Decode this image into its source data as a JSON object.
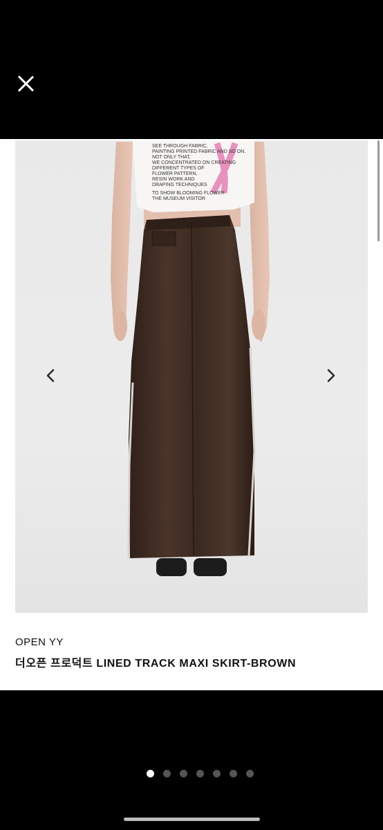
{
  "viewer": {
    "close_icon": "close-icon",
    "prev_icon": "chevron-left-icon",
    "next_icon": "chevron-right-icon",
    "active_page": 1,
    "page_count": 7
  },
  "product": {
    "brand": "OPEN YY",
    "title": "더오픈 프로덕트 LINED TRACK MAXI SKIRT-BROWN",
    "image": {
      "shirt_print": [
        "SEE THROUGH FABRIC,",
        "PAINTING PRINTED FABRIC AND SO ON.",
        "NOT ONLY THAT,",
        "WE CONCENTRATED ON CREATING",
        "DIFFERENT TYPES OF",
        "FLOWER PATTERN,",
        "RESIN WORK AND",
        "DRAPING TECHNIQUES",
        "",
        "TO SHOW BLOOMING FLOWER",
        "THE MUSEUM VISITOR"
      ],
      "skirt_color": "#3d2a20",
      "stripe_color": "#d8d4d0"
    }
  },
  "colors": {
    "background": "#000000",
    "card": "#ffffff",
    "dot_active": "#ffffff",
    "dot_inactive": "#555555"
  }
}
